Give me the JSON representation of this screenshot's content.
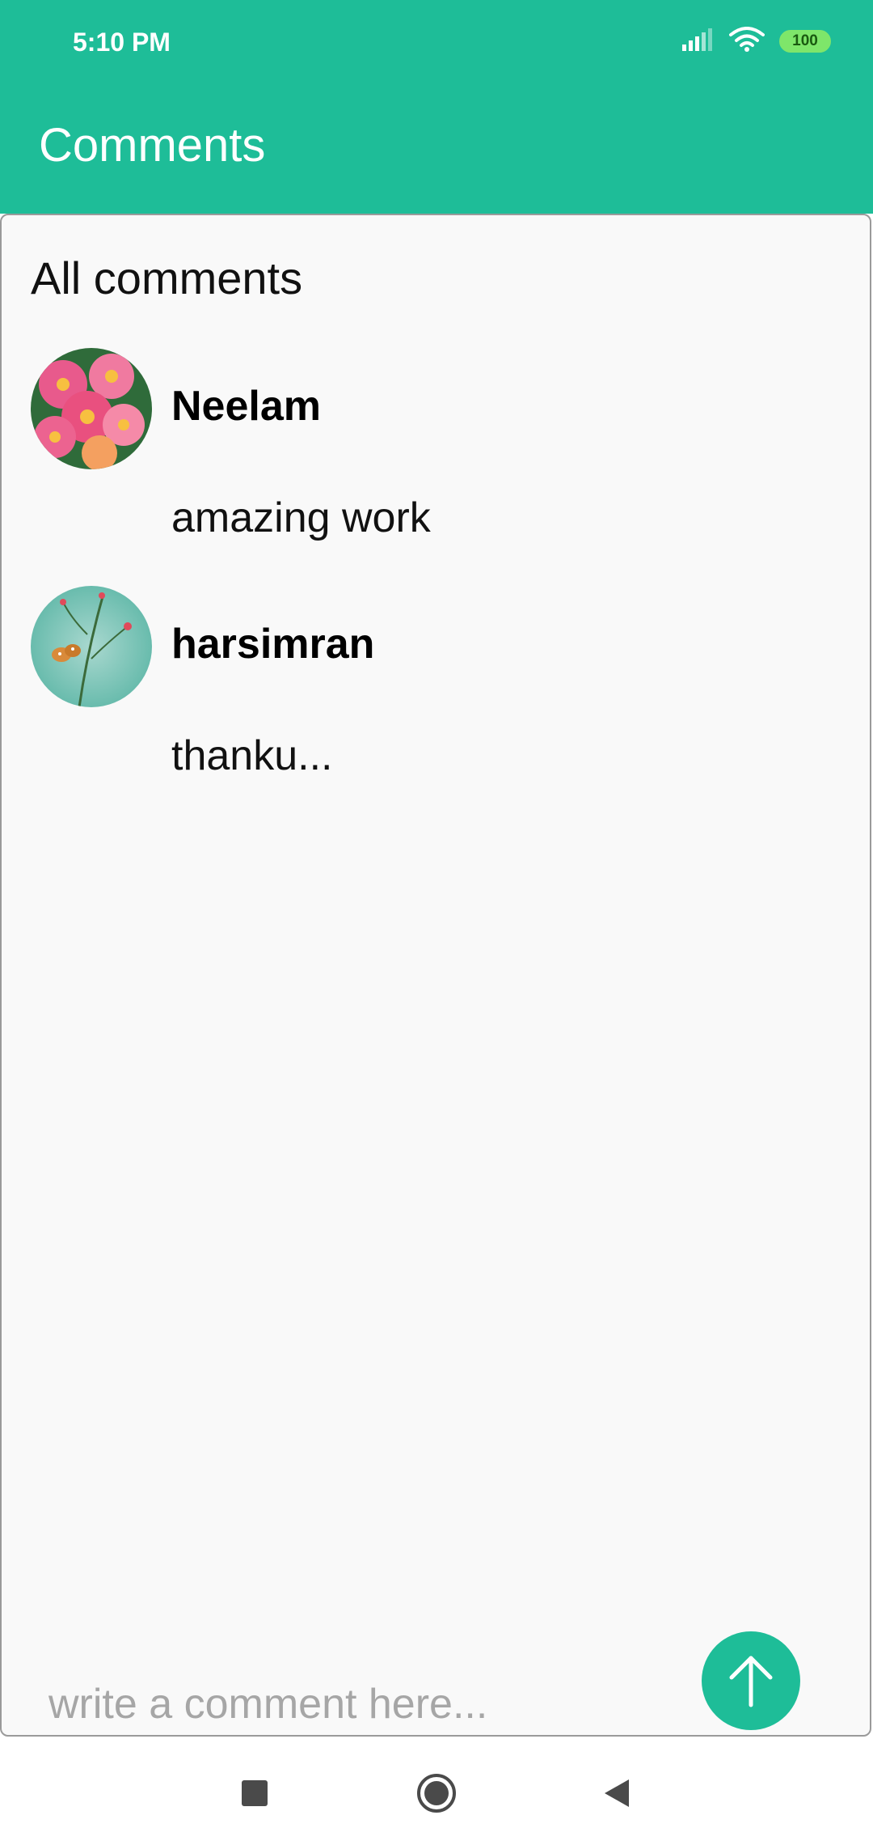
{
  "status_bar": {
    "time": "5:10 PM",
    "battery": "100",
    "icons": [
      "signal-icon",
      "wifi-icon",
      "battery-icon"
    ]
  },
  "app_bar": {
    "title": "Comments"
  },
  "main": {
    "section_title": "All comments",
    "comments": [
      {
        "name": "Neelam",
        "text": "amazing work",
        "avatar": "flower-avatar"
      },
      {
        "name": "harsimran",
        "text": "thanku...",
        "avatar": "butterfly-avatar"
      }
    ]
  },
  "composer": {
    "placeholder": "write a comment here...",
    "send_icon": "arrow-up-icon"
  },
  "nav_bar": {
    "icons": [
      "square-icon",
      "circle-home-icon",
      "back-triangle-icon"
    ]
  },
  "colors": {
    "accent": "#1ebd98",
    "panel_bg": "#f9f9f9",
    "placeholder": "#a6a6a6"
  }
}
